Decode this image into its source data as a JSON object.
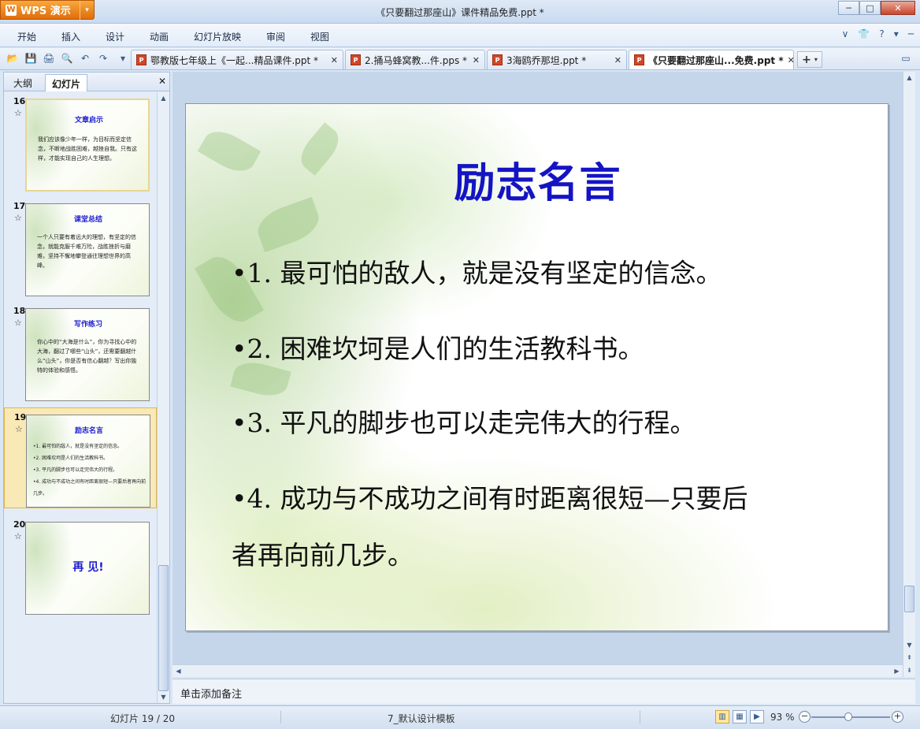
{
  "app": {
    "logo_letter": "W",
    "name": "WPS 演示",
    "caret": "▾"
  },
  "window": {
    "title": "《只要翻过那座山》课件精品免费.ppt *",
    "minimize": "─",
    "maximize": "□",
    "close": "✕"
  },
  "menu": {
    "items": [
      "开始",
      "插入",
      "设计",
      "动画",
      "幻灯片放映",
      "审阅",
      "视图"
    ],
    "right_icons": [
      "chevron-down-icon",
      "shirt-icon",
      "help-icon",
      "minimize-ribbon-icon"
    ],
    "right_glyphs": [
      "∨",
      "👕",
      "?",
      "▾",
      "─"
    ]
  },
  "toolbar": {
    "icons": [
      "open-folder-icon",
      "save-icon",
      "print-icon",
      "print-preview-icon",
      "undo-icon",
      "redo-icon",
      "customize-icon"
    ],
    "glyphs": [
      "📂",
      "💾",
      "🖨",
      "🔍",
      "↶",
      "↷",
      "▾"
    ]
  },
  "doc_tabs": [
    {
      "label": "鄂教版七年级上《一起...精品课件.ppt *",
      "close": "✕"
    },
    {
      "label": "2.捅马蜂窝教...件.pps *",
      "close": "✕"
    },
    {
      "label": "3海鸥乔那坦.ppt *",
      "close": "✕"
    },
    {
      "label": "《只要翻过那座山...免费.ppt *",
      "close": "✕"
    }
  ],
  "tab_add": "+",
  "left_panel": {
    "tabs": [
      "大纲",
      "幻灯片"
    ],
    "close": "✕",
    "thumbnails": [
      {
        "num": "16",
        "star": "☆",
        "title": "文章启示",
        "body": "我们应该像少年一样，为目标而坚定信念，不断地战胜困难，越挫自我。只有这样，才能实现自己的人生理想。"
      },
      {
        "num": "17",
        "star": "☆",
        "title": "课堂总结",
        "body": "一个人只要有着远大的理想，有坚定的信念，就能克服千难万险，战胜挫折与磨难，坚持不懈地攀登通往理想世界的高峰。"
      },
      {
        "num": "18",
        "star": "☆",
        "title": "写作练习",
        "body": "你心中的“大海是什么”，你为寻找心中的大海，翻过了哪些“山头”，还需要翻越什么“山头”，你是否有信心翻越？写出你独特的体验和感悟。"
      },
      {
        "num": "19",
        "star": "☆",
        "title": "励志名言",
        "lines": [
          "•1. 最可怕的敌人，就是没有坚定的信念。",
          "•2. 困难坎坷是人们的生活教科书。",
          "•3. 平凡的脚步也可以走完伟大的行程。",
          "•4. 成功与不成功之间有时距离很短—只要后者再向前几步。"
        ]
      },
      {
        "num": "20",
        "star": "☆",
        "big": "再 见!"
      }
    ]
  },
  "slide": {
    "title": "励志名言",
    "lines": [
      "•1. 最可怕的敌人，就是没有坚定的信念。",
      "•2. 困难坎坷是人们的生活教科书。",
      "•3. 平凡的脚步也可以走完伟大的行程。",
      "•4. 成功与不成功之间有时距离很短—只要后",
      "者再向前几步。"
    ]
  },
  "notes_placeholder": "单击添加备注",
  "status": {
    "slide_info": "幻灯片 19 / 20",
    "template": "7_默认设计模板",
    "zoom": "93 %",
    "zoom_level": 0.47,
    "view_icons": [
      "normal-view-icon",
      "slide-sorter-icon",
      "slideshow-icon"
    ],
    "zoom_out": "−",
    "zoom_in": "+"
  },
  "colors": {
    "accent": "#e06d0a",
    "title_blue": "#1414c4",
    "selection": "#f8e9b6"
  }
}
